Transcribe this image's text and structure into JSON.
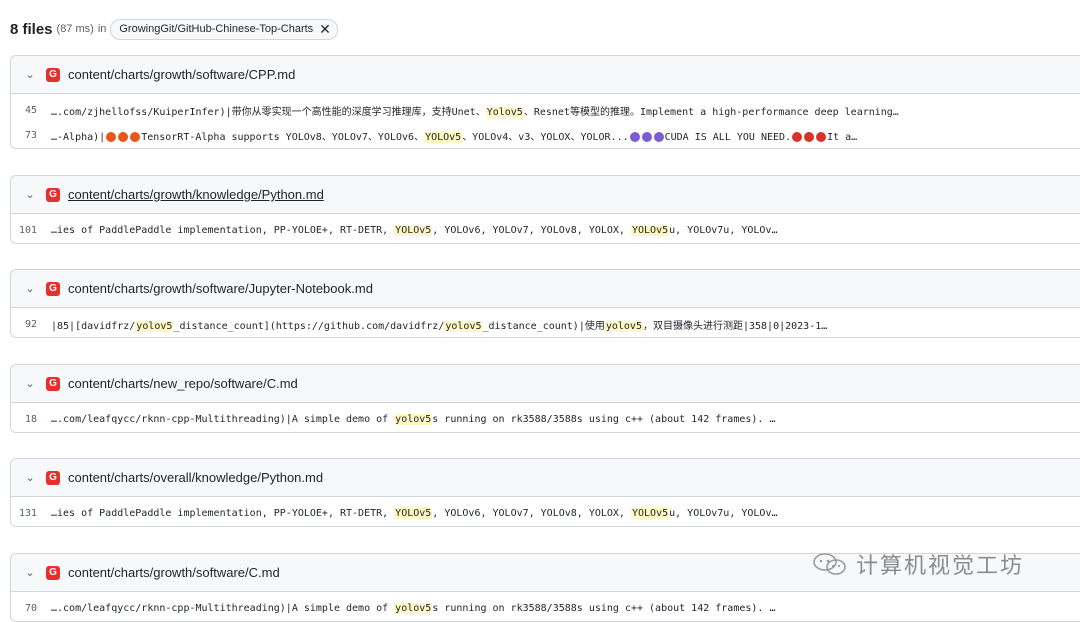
{
  "header": {
    "count": "8 files",
    "time": "(87 ms)",
    "in": "in",
    "repo": "GrowingGit/GitHub-Chinese-Top-Charts",
    "close": "✕"
  },
  "results": [
    {
      "path": "content/charts/growth/software/CPP.md",
      "underline": false,
      "lines": [
        {
          "num": "45",
          "html": "….com/zjhellofss/KuiperInfer)|带你从零实现一个高性能的深度学习推理库，支持Unet、<mark>Yolov5</mark>、Resnet等模型的推理。Implement a high-performance deep learning…"
        },
        {
          "num": "73",
          "html": "…-Alpha)|<span class=\"emoji fire\"></span><span class=\"emoji fire\"></span><span class=\"emoji fire\"></span>TensorRT-Alpha supports YOLOv8、YOLOv7、YOLOv6、<mark>YOLOv5</mark>、YOLOv4、v3、YOLOX、YOLOR...<span class=\"emoji rocket\"></span><span class=\"emoji rocket\"></span><span class=\"emoji rocket\"></span>CUDA IS ALL YOU NEED.<span class=\"emoji tomato\"></span><span class=\"emoji tomato\"></span><span class=\"emoji tomato\"></span>It a…"
        }
      ]
    },
    {
      "path": "content/charts/growth/knowledge/Python.md",
      "underline": true,
      "lines": [
        {
          "num": "101",
          "html": "…ies of PaddlePaddle implementation, PP-YOLOE+, RT-DETR, <mark>YOLOv5</mark>, YOLOv6, YOLOv7, YOLOv8, YOLOX, <mark>YOLOv5</mark>u, YOLOv7u, YOLOv…"
        }
      ]
    },
    {
      "path": "content/charts/growth/software/Jupyter-Notebook.md",
      "underline": false,
      "lines": [
        {
          "num": "92",
          "html": "|85|[davidfrz/<mark>yolov5</mark>_distance_count](https://github.com/davidfrz/<mark>yolov5</mark>_distance_count)|使用<mark>yolov5</mark>，双目摄像头进行测距|358|0|2023-1…"
        }
      ]
    },
    {
      "path": "content/charts/new_repo/software/C.md",
      "underline": false,
      "lines": [
        {
          "num": "18",
          "html": "….com/leafqycc/rknn-cpp-Multithreading)|A simple demo of <mark>yolov5</mark>s running on rk3588/3588s using c++ (about 142 frames). …"
        }
      ]
    },
    {
      "path": "content/charts/overall/knowledge/Python.md",
      "underline": false,
      "lines": [
        {
          "num": "131",
          "html": "…ies of PaddlePaddle implementation, PP-YOLOE+, RT-DETR, <mark>YOLOv5</mark>, YOLOv6, YOLOv7, YOLOv8, YOLOX, <mark>YOLOv5</mark>u, YOLOv7u, YOLOv…"
        }
      ]
    },
    {
      "path": "content/charts/growth/software/C.md",
      "underline": false,
      "lines": [
        {
          "num": "70",
          "html": "….com/leafqycc/rknn-cpp-Multithreading)|A simple demo of <mark>yolov5</mark>s running on rk3588/3588s using c++ (about 142 frames). …"
        }
      ]
    }
  ],
  "file_icon_letter": "G",
  "watermark": "计算机视觉工坊"
}
